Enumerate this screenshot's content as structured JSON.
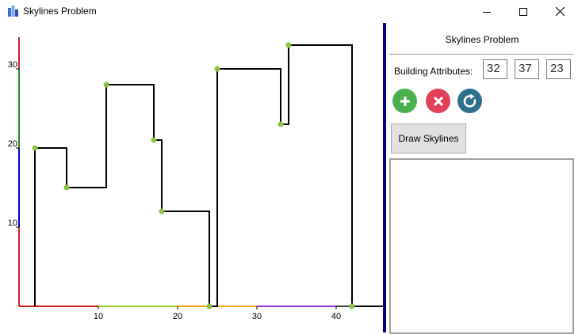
{
  "window": {
    "title": "Skylines Problem",
    "controls": [
      "minimize-icon",
      "maximize-icon",
      "close-icon"
    ]
  },
  "panel": {
    "title": "Skylines Problem",
    "attributes_label": "Building Attributes:",
    "attribute_values": [
      "32",
      "37",
      "23"
    ],
    "add_icon": "plus-icon",
    "remove_icon": "x-icon",
    "reset_icon": "refresh-icon",
    "draw_button_label": "Draw Skylines",
    "colors": {
      "add": "#4caf50",
      "remove": "#e04058",
      "reset": "#2e6f8a"
    }
  },
  "plot": {
    "x_ticks": [
      "10",
      "20",
      "30",
      "40"
    ],
    "y_ticks": [
      "10",
      "20",
      "30"
    ],
    "skyline_points": [
      [
        2,
        0
      ],
      [
        2,
        20
      ],
      [
        6,
        20
      ],
      [
        6,
        15
      ],
      [
        11,
        15
      ],
      [
        11,
        28
      ],
      [
        17,
        28
      ],
      [
        17,
        21
      ],
      [
        18,
        21
      ],
      [
        18,
        12
      ],
      [
        24,
        12
      ],
      [
        24,
        0
      ],
      [
        25,
        0
      ],
      [
        25,
        30
      ],
      [
        33,
        30
      ],
      [
        33,
        23
      ],
      [
        34,
        23
      ],
      [
        34,
        33
      ],
      [
        42,
        33
      ],
      [
        42,
        0
      ],
      [
        46,
        0
      ]
    ],
    "key_points": [
      [
        2,
        20
      ],
      [
        6,
        15
      ],
      [
        11,
        28
      ],
      [
        17,
        21
      ],
      [
        18,
        12
      ],
      [
        24,
        0
      ],
      [
        25,
        30
      ],
      [
        33,
        23
      ],
      [
        34,
        33
      ],
      [
        42,
        0
      ]
    ],
    "point_color": "#8bc34a",
    "x_axis_colors": [
      "#cc2222",
      "#9acd32",
      "#ffa500",
      "#9932cc"
    ],
    "y_axis_colors": [
      "#cc2222",
      "#0000cc",
      "#228b22",
      "#cc2222"
    ]
  }
}
